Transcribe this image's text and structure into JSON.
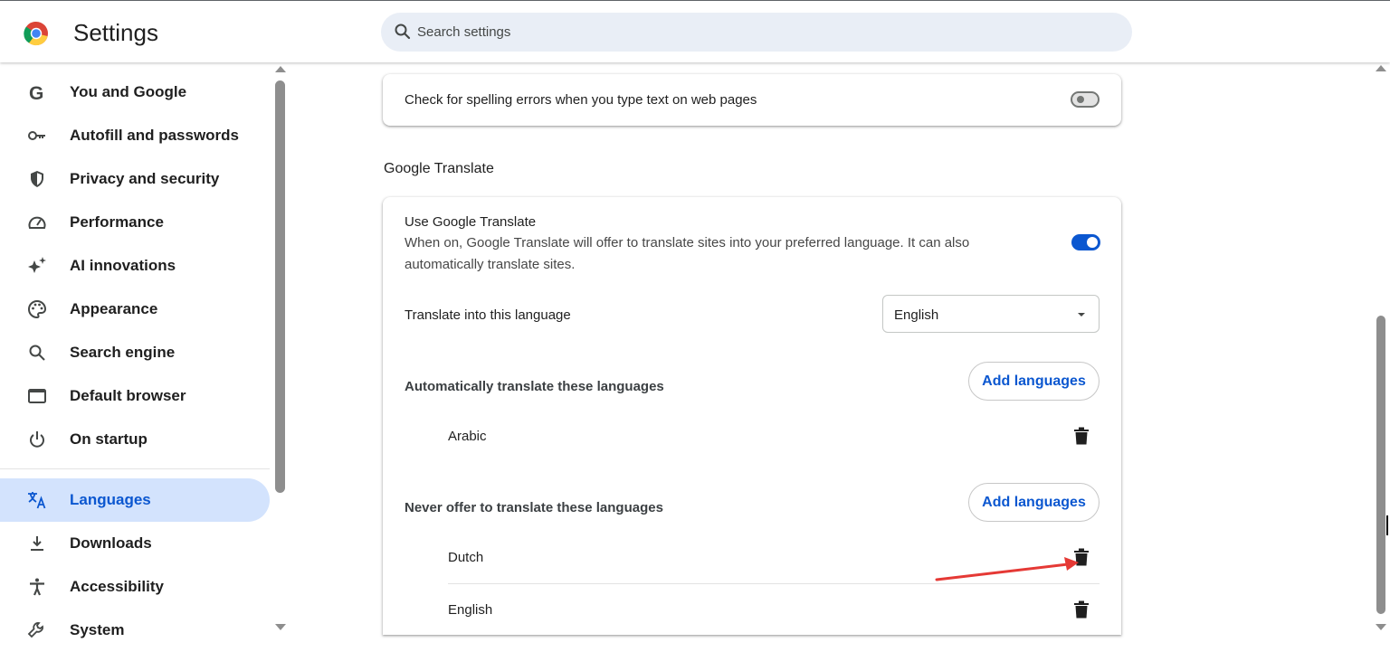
{
  "header": {
    "title": "Settings",
    "search_placeholder": "Search settings"
  },
  "sidebar": {
    "items": [
      {
        "label": "You and Google",
        "icon": "google-g-icon"
      },
      {
        "label": "Autofill and passwords",
        "icon": "key-icon"
      },
      {
        "label": "Privacy and security",
        "icon": "shield-icon"
      },
      {
        "label": "Performance",
        "icon": "speedometer-icon"
      },
      {
        "label": "AI innovations",
        "icon": "sparkle-icon"
      },
      {
        "label": "Appearance",
        "icon": "palette-icon"
      },
      {
        "label": "Search engine",
        "icon": "search-icon"
      },
      {
        "label": "Default browser",
        "icon": "browser-window-icon"
      },
      {
        "label": "On startup",
        "icon": "power-icon"
      },
      {
        "label": "Languages",
        "icon": "translate-icon",
        "active": true
      },
      {
        "label": "Downloads",
        "icon": "download-icon"
      },
      {
        "label": "Accessibility",
        "icon": "accessibility-icon"
      },
      {
        "label": "System",
        "icon": "wrench-icon"
      }
    ]
  },
  "main": {
    "spellcheck": {
      "label": "Check for spelling errors when you type text on web pages",
      "enabled": false
    },
    "translate_section_title": "Google Translate",
    "use_translate": {
      "title": "Use Google Translate",
      "description": "When on, Google Translate will offer to translate sites into your preferred language. It can also automatically translate sites.",
      "enabled": true
    },
    "target_language": {
      "label": "Translate into this language",
      "value": "English"
    },
    "auto_translate": {
      "label": "Automatically translate these languages",
      "button": "Add languages",
      "languages": [
        "Arabic"
      ]
    },
    "never_translate": {
      "label": "Never offer to translate these languages",
      "button": "Add languages",
      "languages": [
        "Dutch",
        "English"
      ]
    }
  },
  "colors": {
    "accent": "#0b57d0",
    "active_nav_bg": "#d3e3fd",
    "annotation_arrow": "#e53935"
  }
}
